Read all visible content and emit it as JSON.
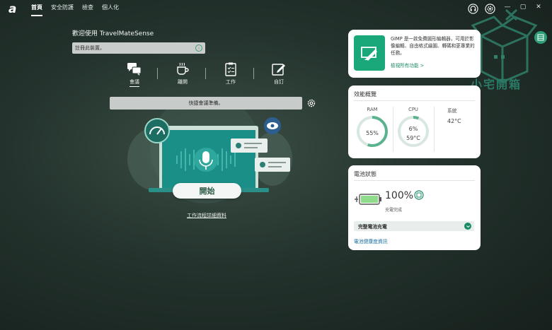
{
  "app": {
    "logo": "a"
  },
  "nav": [
    {
      "label": "首頁",
      "active": true
    },
    {
      "label": "安全防護",
      "active": false
    },
    {
      "label": "檢查",
      "active": false
    },
    {
      "label": "個人化",
      "active": false
    }
  ],
  "window_controls": {
    "minimize": "—",
    "restore": "▢",
    "close": "✕"
  },
  "welcome": {
    "text": "歡迎使用 TravelMateSense"
  },
  "register": {
    "placeholder": "註冊此裝置。"
  },
  "modes": [
    {
      "label": "會議",
      "icon": "meeting-icon",
      "active": true
    },
    {
      "label": "離開",
      "icon": "coffee-icon",
      "active": false
    },
    {
      "label": "工作",
      "icon": "clipboard-icon",
      "active": false
    },
    {
      "label": "自訂",
      "icon": "edit-icon",
      "active": false
    }
  ],
  "quick": {
    "text": "快捷會議準備。"
  },
  "start": {
    "label": "開始"
  },
  "workflow": {
    "link": "工作流程詳細資料"
  },
  "gimp": {
    "text": "GIMP 是一款免費圖形編輯器，可用於影像編輯、自由格式繪圖、轉碼和更專業的任務。",
    "link": "檢視所有功能 >",
    "tile_color": "#1aa87a"
  },
  "performance": {
    "title": "效能概覽",
    "ram": {
      "label": "RAM",
      "value": "55%",
      "percent": 55
    },
    "cpu": {
      "label": "CPU",
      "usage": "6%",
      "temp": "59°C",
      "percent": 6
    },
    "system": {
      "label": "系統",
      "temp": "42°C"
    }
  },
  "battery": {
    "title": "電池狀態",
    "percent_text": "100%",
    "percent": 100,
    "status": "充電完成",
    "charge_option": "完整電池充電",
    "health_link": "電池健康度資訊"
  },
  "watermark": {
    "text": "小宅開箱"
  },
  "colors": {
    "accent": "#1a8a64",
    "bg": "#24332d"
  }
}
